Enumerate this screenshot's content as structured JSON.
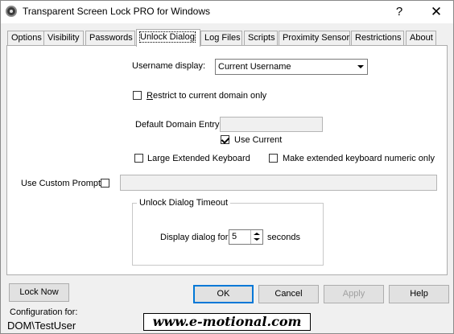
{
  "window": {
    "title": "Transparent Screen Lock PRO for Windows",
    "help_glyph": "?",
    "close_glyph": "✕"
  },
  "tabs": [
    {
      "label": "Options",
      "active": false
    },
    {
      "label": "Visibility",
      "active": false
    },
    {
      "label": "Passwords",
      "active": false
    },
    {
      "label": "Unlock Dialog",
      "active": true
    },
    {
      "label": "Log Files",
      "active": false
    },
    {
      "label": "Scripts",
      "active": false
    },
    {
      "label": "Proximity Sensor",
      "active": false
    },
    {
      "label": "Restrictions",
      "active": false
    },
    {
      "label": "About",
      "active": false
    }
  ],
  "unlock_dialog": {
    "username_display_label": "Username display:",
    "username_display_value": "Current Username",
    "restrict_domain_label": "Restrict to current domain only",
    "restrict_domain_checked": false,
    "default_domain_label": "Default Domain Entry",
    "default_domain_value": "",
    "use_current_label": "Use Current",
    "use_current_checked": true,
    "large_keyboard_label": "Large Extended Keyboard",
    "large_keyboard_checked": false,
    "numeric_keyboard_label": "Make extended keyboard numeric only",
    "numeric_keyboard_checked": false,
    "custom_prompt_label": "Use Custom Prompt",
    "custom_prompt_checked": false,
    "custom_prompt_value": "",
    "timeout_group_title": "Unlock Dialog Timeout",
    "display_dialog_label": "Display dialog for",
    "timeout_value": "5",
    "seconds_label": "seconds"
  },
  "footer": {
    "lock_now": "Lock Now",
    "ok": "OK",
    "cancel": "Cancel",
    "apply": "Apply",
    "help": "Help",
    "config_label": "Configuration for:",
    "config_user": "DOM\\TestUser",
    "banner": "www.e-motional.com"
  },
  "colors": {
    "focus_blue": "#0078d7",
    "disabled_text": "#a0a0a0"
  }
}
